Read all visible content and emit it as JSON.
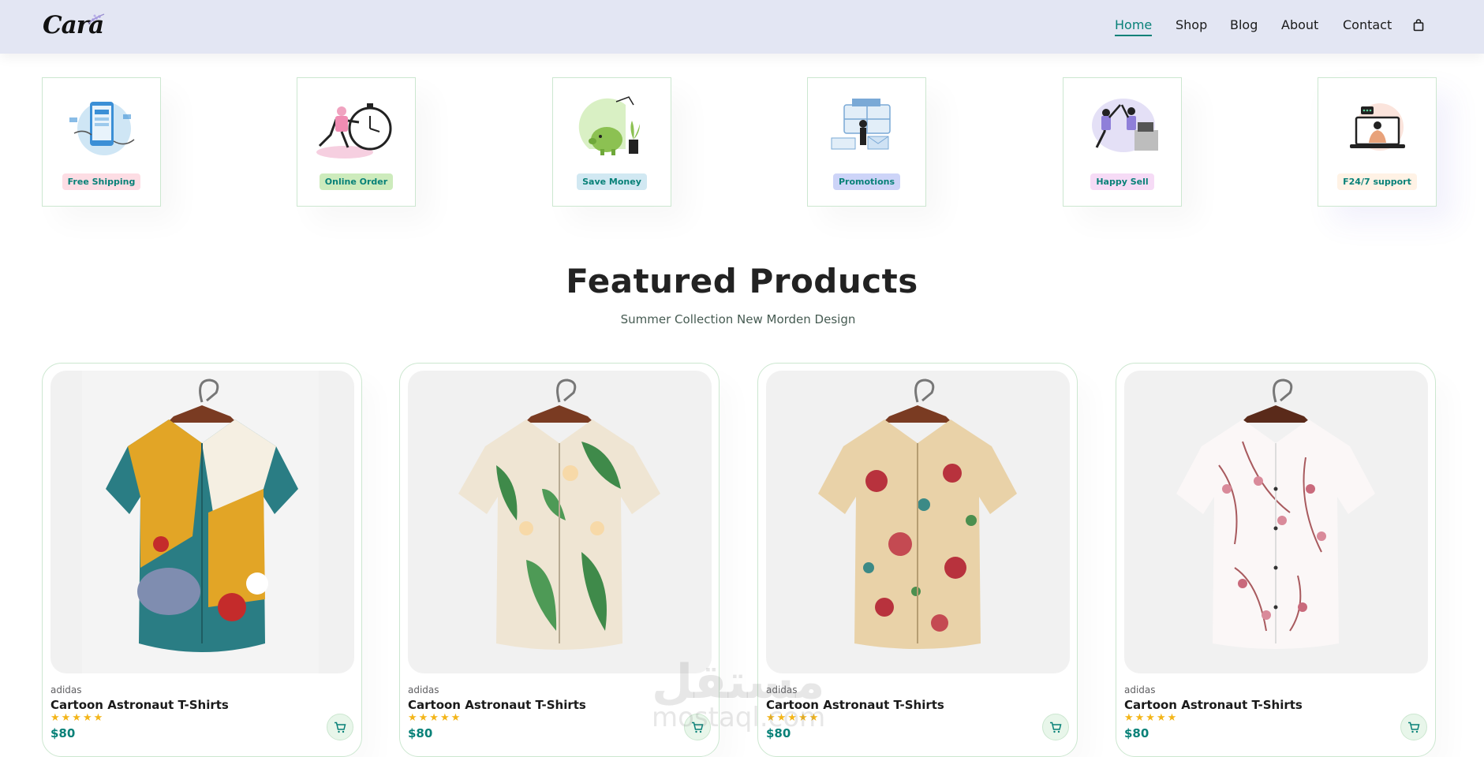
{
  "header": {
    "logo": "Cara",
    "nav": [
      {
        "label": "Home",
        "active": true
      },
      {
        "label": "Shop",
        "active": false
      },
      {
        "label": "Blog",
        "active": false
      },
      {
        "label": "About",
        "active": false
      },
      {
        "label": "Contact",
        "active": false
      }
    ],
    "cart_icon": "shopping-bag-icon"
  },
  "features": [
    {
      "label": "Free Shipping",
      "tag_color": "#fddde4",
      "icon": "phone-delivery-illustration"
    },
    {
      "label": "Online Order",
      "tag_color": "#cdebbc",
      "icon": "stopwatch-runner-illustration"
    },
    {
      "label": "Save Money",
      "tag_color": "#d1e8f2",
      "icon": "piggy-bank-illustration"
    },
    {
      "label": "Promotions",
      "tag_color": "#cdd4f8",
      "icon": "promotions-illustration"
    },
    {
      "label": "Happy Sell",
      "tag_color": "#f6dbf6",
      "icon": "high-five-illustration"
    },
    {
      "label": "F24/7 support",
      "tag_color": "#fff2e5",
      "icon": "laptop-support-illustration"
    }
  ],
  "section": {
    "title": "Featured Products",
    "subtitle": "Summer Collection New Morden Design"
  },
  "products": [
    {
      "brand": "adidas",
      "name": "Cartoon Astronaut T-Shirts",
      "stars": "★★★★★",
      "rating": 5,
      "price": "$80",
      "image": "multicolor-abstract-shirt"
    },
    {
      "brand": "adidas",
      "name": "Cartoon Astronaut T-Shirts",
      "stars": "★★★★★",
      "rating": 5,
      "price": "$80",
      "image": "tropical-leaf-shirt"
    },
    {
      "brand": "adidas",
      "name": "Cartoon Astronaut T-Shirts",
      "stars": "★★★★★",
      "rating": 5,
      "price": "$80",
      "image": "floral-print-shirt"
    },
    {
      "brand": "adidas",
      "name": "Cartoon Astronaut T-Shirts",
      "stars": "★★★★★",
      "rating": 5,
      "price": "$80",
      "image": "pink-blossom-shirt"
    }
  ],
  "watermark": "مستقل",
  "watermark_latin": "mostaql.com",
  "colors": {
    "accent": "#088178",
    "header_bg": "#e3e6f3",
    "card_border": "#cce7d0",
    "star": "#f3b519"
  }
}
